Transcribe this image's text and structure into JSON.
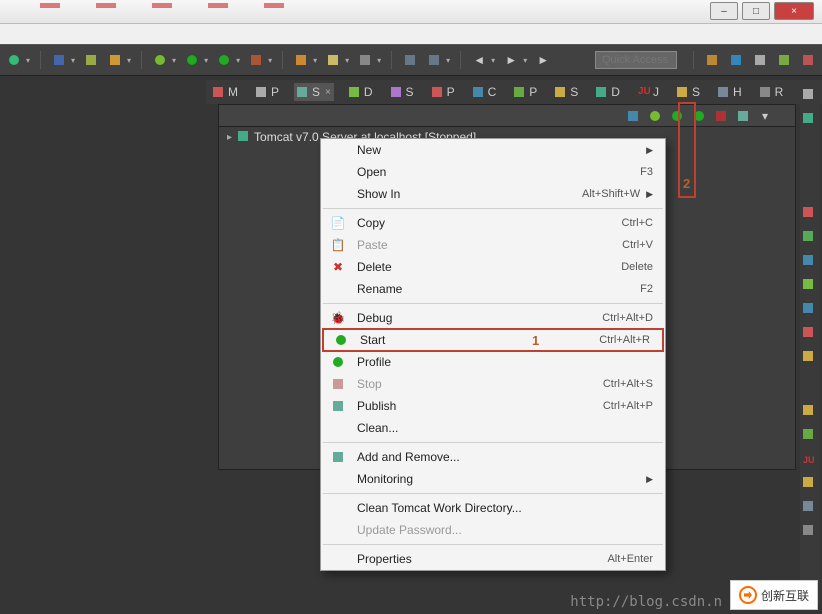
{
  "window": {
    "minimize": "–",
    "maximize": "□",
    "close": "×"
  },
  "toolbar": {
    "quick_access_placeholder": "Quick Access"
  },
  "tabs": [
    {
      "letter": "M"
    },
    {
      "letter": "P"
    },
    {
      "letter": "S",
      "active": true
    },
    {
      "letter": "D"
    },
    {
      "letter": "S"
    },
    {
      "letter": "P"
    },
    {
      "letter": "C"
    },
    {
      "letter": "P"
    },
    {
      "letter": "S"
    },
    {
      "letter": "D"
    },
    {
      "letter": "J"
    },
    {
      "letter": "S"
    },
    {
      "letter": "H"
    },
    {
      "letter": "R"
    }
  ],
  "tree": {
    "server_label": "Tomcat v7.0 Server at localhost  [Stopped]"
  },
  "annotations": {
    "num1": "1",
    "num2": "2"
  },
  "menu": {
    "new": "New",
    "open": "Open",
    "open_key": "F3",
    "show_in": "Show In",
    "show_in_key": "Alt+Shift+W",
    "copy": "Copy",
    "copy_key": "Ctrl+C",
    "paste": "Paste",
    "paste_key": "Ctrl+V",
    "delete": "Delete",
    "delete_key": "Delete",
    "rename": "Rename",
    "rename_key": "F2",
    "debug": "Debug",
    "debug_key": "Ctrl+Alt+D",
    "start": "Start",
    "start_key": "Ctrl+Alt+R",
    "profile": "Profile",
    "stop": "Stop",
    "stop_key": "Ctrl+Alt+S",
    "publish": "Publish",
    "publish_key": "Ctrl+Alt+P",
    "clean": "Clean...",
    "add_remove": "Add and Remove...",
    "monitoring": "Monitoring",
    "clean_work": "Clean Tomcat Work Directory...",
    "update_pw": "Update Password...",
    "properties": "Properties",
    "properties_key": "Alt+Enter"
  },
  "watermark": "http://blog.csdn.n",
  "logo_text": "创新互联"
}
